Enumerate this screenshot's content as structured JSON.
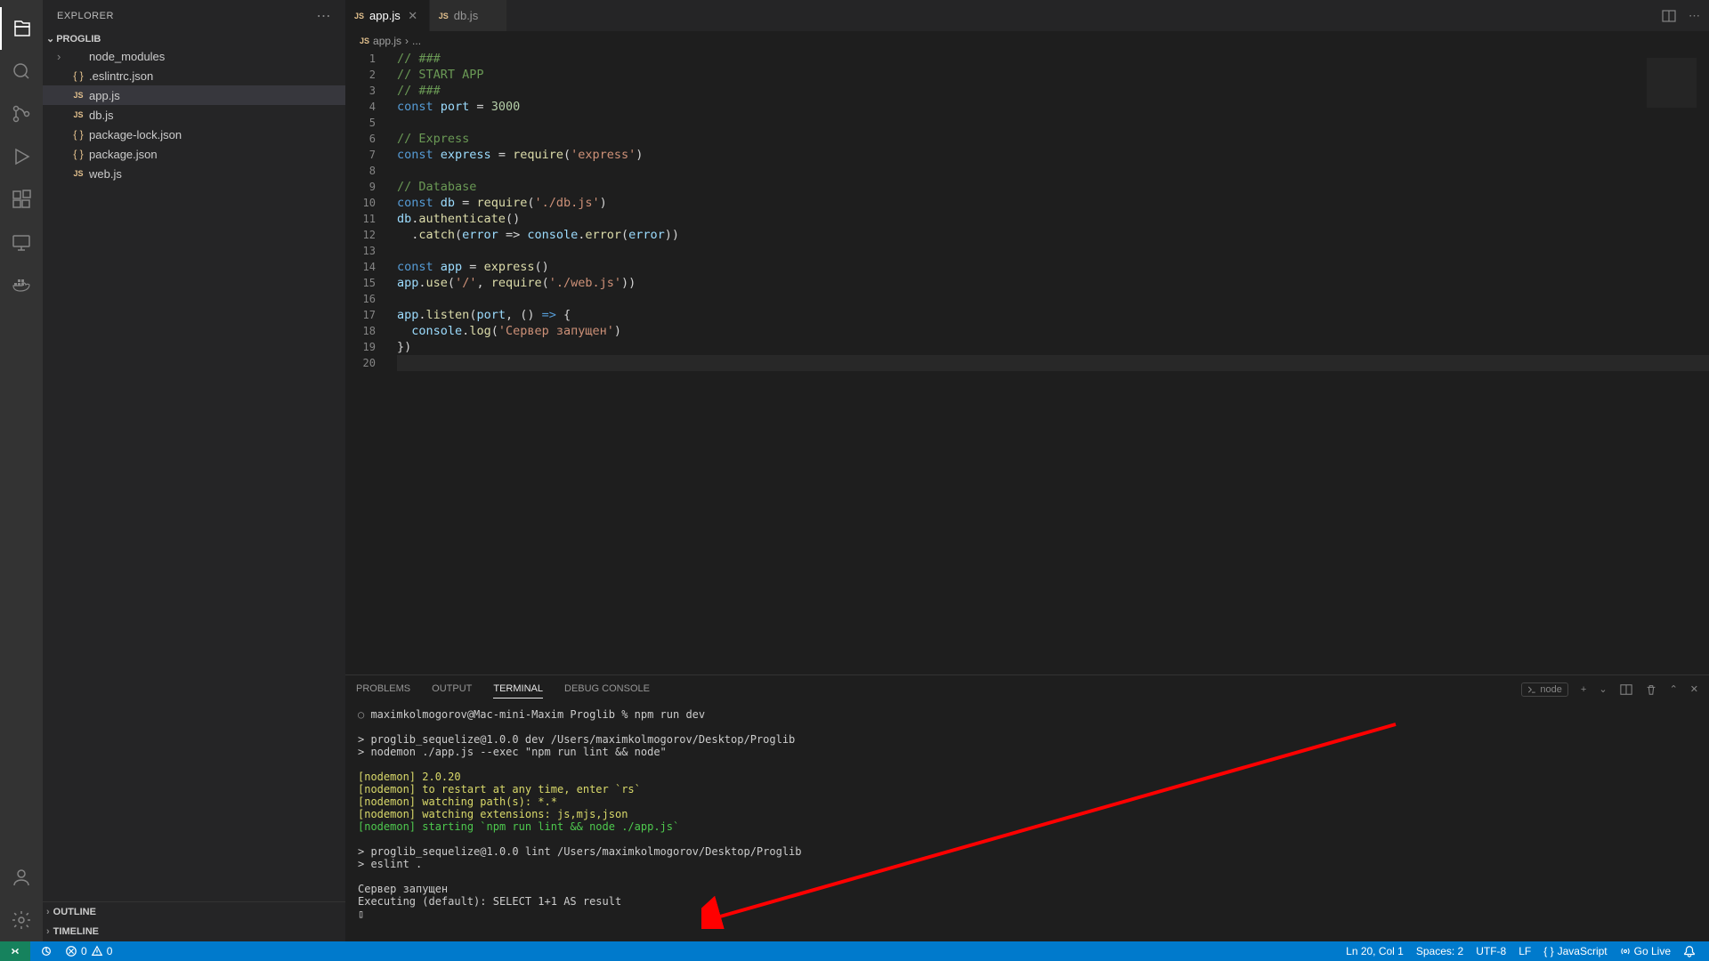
{
  "sidebar": {
    "title": "EXPLORER",
    "root": "PROGLIB",
    "items": [
      {
        "label": "node_modules",
        "type": "folder"
      },
      {
        "label": ".eslintrc.json",
        "type": "json"
      },
      {
        "label": "app.js",
        "type": "js",
        "selected": true
      },
      {
        "label": "db.js",
        "type": "js"
      },
      {
        "label": "package-lock.json",
        "type": "json"
      },
      {
        "label": "package.json",
        "type": "json"
      },
      {
        "label": "web.js",
        "type": "js"
      }
    ],
    "bottom": [
      "OUTLINE",
      "TIMELINE"
    ]
  },
  "tabs": [
    {
      "label": "app.js",
      "icon": "js",
      "active": true
    },
    {
      "label": "db.js",
      "icon": "js",
      "active": false
    }
  ],
  "breadcrumb": {
    "file": "app.js",
    "rest": "..."
  },
  "editor_lines": [
    [
      {
        "c": "c-cmt",
        "t": "// ###"
      }
    ],
    [
      {
        "c": "c-cmt",
        "t": "// START APP"
      }
    ],
    [
      {
        "c": "c-cmt",
        "t": "// ###"
      }
    ],
    [
      {
        "c": "c-kw",
        "t": "const "
      },
      {
        "c": "c-var",
        "t": "port"
      },
      {
        "c": "c-punc",
        "t": " = "
      },
      {
        "c": "c-num",
        "t": "3000"
      }
    ],
    [],
    [
      {
        "c": "c-cmt",
        "t": "// Express"
      }
    ],
    [
      {
        "c": "c-kw",
        "t": "const "
      },
      {
        "c": "c-var",
        "t": "express"
      },
      {
        "c": "c-punc",
        "t": " = "
      },
      {
        "c": "c-fn",
        "t": "require"
      },
      {
        "c": "c-punc",
        "t": "("
      },
      {
        "c": "c-str",
        "t": "'express'"
      },
      {
        "c": "c-punc",
        "t": ")"
      }
    ],
    [],
    [
      {
        "c": "c-cmt",
        "t": "// Database"
      }
    ],
    [
      {
        "c": "c-kw",
        "t": "const "
      },
      {
        "c": "c-var",
        "t": "db"
      },
      {
        "c": "c-punc",
        "t": " = "
      },
      {
        "c": "c-fn",
        "t": "require"
      },
      {
        "c": "c-punc",
        "t": "("
      },
      {
        "c": "c-str",
        "t": "'./db.js'"
      },
      {
        "c": "c-punc",
        "t": ")"
      }
    ],
    [
      {
        "c": "c-var",
        "t": "db"
      },
      {
        "c": "c-punc",
        "t": "."
      },
      {
        "c": "c-fn",
        "t": "authenticate"
      },
      {
        "c": "c-punc",
        "t": "()"
      }
    ],
    [
      {
        "c": "c-punc",
        "t": "  ."
      },
      {
        "c": "c-fn",
        "t": "catch"
      },
      {
        "c": "c-punc",
        "t": "("
      },
      {
        "c": "c-var",
        "t": "error"
      },
      {
        "c": "c-punc",
        "t": " => "
      },
      {
        "c": "c-var",
        "t": "console"
      },
      {
        "c": "c-punc",
        "t": "."
      },
      {
        "c": "c-fn",
        "t": "error"
      },
      {
        "c": "c-punc",
        "t": "("
      },
      {
        "c": "c-var",
        "t": "error"
      },
      {
        "c": "c-punc",
        "t": "))"
      }
    ],
    [],
    [
      {
        "c": "c-kw",
        "t": "const "
      },
      {
        "c": "c-var",
        "t": "app"
      },
      {
        "c": "c-punc",
        "t": " = "
      },
      {
        "c": "c-fn",
        "t": "express"
      },
      {
        "c": "c-punc",
        "t": "()"
      }
    ],
    [
      {
        "c": "c-var",
        "t": "app"
      },
      {
        "c": "c-punc",
        "t": "."
      },
      {
        "c": "c-fn",
        "t": "use"
      },
      {
        "c": "c-punc",
        "t": "("
      },
      {
        "c": "c-str",
        "t": "'/'"
      },
      {
        "c": "c-punc",
        "t": ", "
      },
      {
        "c": "c-fn",
        "t": "require"
      },
      {
        "c": "c-punc",
        "t": "("
      },
      {
        "c": "c-str",
        "t": "'./web.js'"
      },
      {
        "c": "c-punc",
        "t": "))"
      }
    ],
    [],
    [
      {
        "c": "c-var",
        "t": "app"
      },
      {
        "c": "c-punc",
        "t": "."
      },
      {
        "c": "c-fn",
        "t": "listen"
      },
      {
        "c": "c-punc",
        "t": "("
      },
      {
        "c": "c-var",
        "t": "port"
      },
      {
        "c": "c-punc",
        "t": ", () "
      },
      {
        "c": "c-kw",
        "t": "=>"
      },
      {
        "c": "c-punc",
        "t": " {"
      }
    ],
    [
      {
        "c": "c-punc",
        "t": "  "
      },
      {
        "c": "c-var",
        "t": "console"
      },
      {
        "c": "c-punc",
        "t": "."
      },
      {
        "c": "c-fn",
        "t": "log"
      },
      {
        "c": "c-punc",
        "t": "("
      },
      {
        "c": "c-str",
        "t": "'Сервер запущен'"
      },
      {
        "c": "c-punc",
        "t": ")"
      }
    ],
    [
      {
        "c": "c-punc",
        "t": "})"
      }
    ],
    []
  ],
  "panel": {
    "tabs": [
      "PROBLEMS",
      "OUTPUT",
      "TERMINAL",
      "DEBUG CONSOLE"
    ],
    "active": "TERMINAL",
    "shell_label": "node"
  },
  "terminal_lines": [
    {
      "cls": "t-dim",
      "pre": "○ ",
      "text": "maximkolmogorov@Mac-mini-Maxim Proglib % npm run dev"
    },
    {
      "cls": "",
      "text": ""
    },
    {
      "cls": "",
      "text": "> proglib_sequelize@1.0.0 dev /Users/maximkolmogorov/Desktop/Proglib"
    },
    {
      "cls": "",
      "text": "> nodemon ./app.js --exec \"npm run lint && node\""
    },
    {
      "cls": "",
      "text": ""
    },
    {
      "cls": "t-yellow",
      "text": "[nodemon] 2.0.20"
    },
    {
      "cls": "t-yellow",
      "text": "[nodemon] to restart at any time, enter `rs`"
    },
    {
      "cls": "t-yellow",
      "text": "[nodemon] watching path(s): *.*"
    },
    {
      "cls": "t-yellow",
      "text": "[nodemon] watching extensions: js,mjs,json"
    },
    {
      "cls": "t-green",
      "text": "[nodemon] starting `npm run lint && node ./app.js`"
    },
    {
      "cls": "",
      "text": ""
    },
    {
      "cls": "",
      "text": "> proglib_sequelize@1.0.0 lint /Users/maximkolmogorov/Desktop/Proglib"
    },
    {
      "cls": "",
      "text": "> eslint ."
    },
    {
      "cls": "",
      "text": ""
    },
    {
      "cls": "",
      "text": "Сервер запущен"
    },
    {
      "cls": "",
      "text": "Executing (default): SELECT 1+1 AS result"
    },
    {
      "cls": "",
      "text": "▯"
    }
  ],
  "status": {
    "errors": "0",
    "warnings": "0",
    "lncol": "Ln 20, Col 1",
    "spaces": "Spaces: 2",
    "encoding": "UTF-8",
    "eol": "LF",
    "lang": "JavaScript",
    "golive": "Go Live"
  }
}
